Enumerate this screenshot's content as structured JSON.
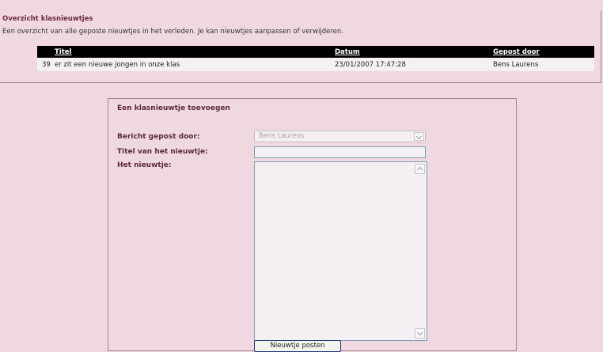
{
  "overview": {
    "title": "Overzicht klasnieuwtjes",
    "description": "Een overzicht van alle geposte nieuwtjes in het verleden. Je kan nieuwtjes aanpassen of verwijderen."
  },
  "table": {
    "headers": {
      "id": "",
      "title": "Titel",
      "date": "Datum",
      "author": "Gepost door"
    },
    "rows": [
      {
        "id": "39",
        "title": "er zit een nieuwe jongen in onze klas",
        "date": "23/01/2007 17:47:28",
        "author": "Bens Laurens"
      }
    ]
  },
  "form": {
    "heading": "Een klasnieuwtje toevoegen",
    "author_label": "Bericht gepost door:",
    "author_selected": "Bens Laurens",
    "title_label": "Titel van het nieuwtje:",
    "title_value": "",
    "body_label": "Het nieuwtje:",
    "body_value": "",
    "submit_label": "Nieuwtje posten"
  },
  "icons": {
    "select_arrow": "chevron-down-icon",
    "scroll_up": "chevron-up-icon",
    "scroll_down": "chevron-down-icon"
  },
  "colors": {
    "page_background": "#f0d8e0",
    "heading_text": "#6b2a45",
    "table_header_bg": "#000000",
    "table_row_bg": "#f5f1f2",
    "input_border": "#7f9db9"
  }
}
